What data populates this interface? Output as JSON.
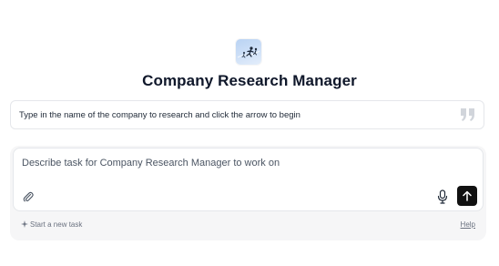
{
  "agent": {
    "name": "Company Research Manager",
    "avatar_icon": "runner-avatar-icon"
  },
  "intro": {
    "text": "Type in the name of the company to research and click the arrow to begin",
    "icon": "quote-icon"
  },
  "composer": {
    "placeholder": "Describe task for Company Research Manager to work on",
    "value": "",
    "attach_icon": "paperclip-icon",
    "mic_icon": "microphone-icon",
    "send_icon": "arrow-up-icon"
  },
  "footer": {
    "new_task_label": "Start a new task",
    "help_label": "Help"
  },
  "colors": {
    "send_button": "#111111",
    "card_border": "#e5e7eb",
    "composer_bg": "#f6f6f7",
    "muted_text": "#6b7280"
  }
}
